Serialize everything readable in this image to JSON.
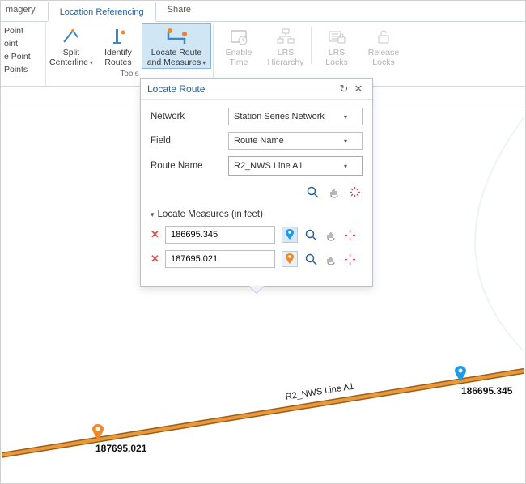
{
  "tabs": {
    "imagery": "magery",
    "location_ref": "Location Referencing",
    "share": "Share"
  },
  "leftcol": {
    "i0": "Point",
    "i1": "oint",
    "i2": "e Point",
    "i3": "Points"
  },
  "ribbon": {
    "split": "Split\nCenterline",
    "identify": "Identify\nRoutes",
    "locate": "Locate Route\nand Measures",
    "enable_time": "Enable\nTime",
    "lrs_hier": "LRS\nHierarchy",
    "lrs_locks": "LRS\nLocks",
    "release_locks": "Release\nLocks",
    "group_tools": "Tools"
  },
  "panel": {
    "title": "Locate Route",
    "network_label": "Network",
    "network_value": "Station Series Network",
    "field_label": "Field",
    "field_value": "Route Name",
    "route_label": "Route Name",
    "route_value": "R2_NWS Line A1",
    "section": "Locate Measures (in feet)",
    "m1": "186695.345",
    "m2": "187695.021"
  },
  "map": {
    "route_text": "R2_NWS Line A1",
    "label_blue": "186695.345",
    "label_orange": "187695.021"
  }
}
